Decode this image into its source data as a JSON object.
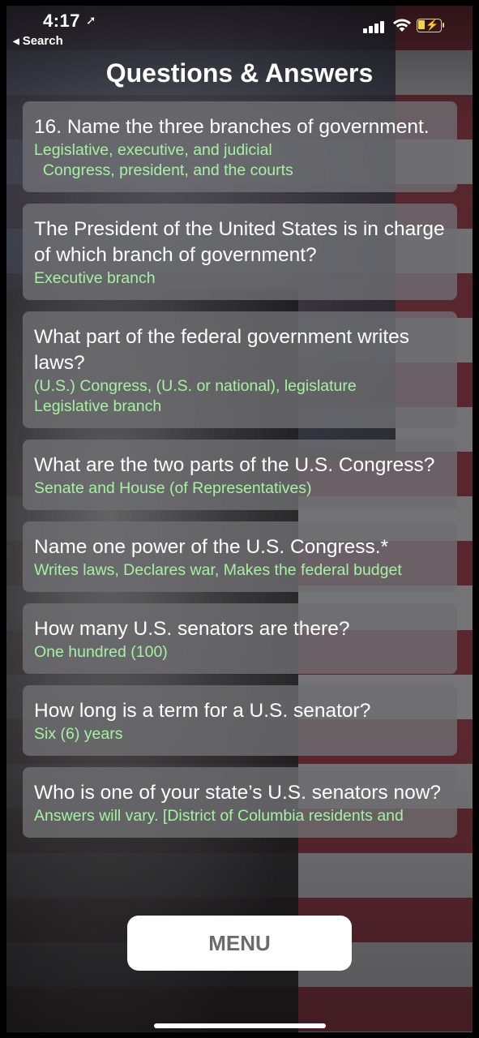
{
  "status_bar": {
    "time": "4:17",
    "back_label": "Search"
  },
  "header": {
    "title": "Questions & Answers"
  },
  "qa_items": [
    {
      "question": "16. Name the three branches of government.",
      "answer": "Legislative, executive, and judicial\n  Congress, president, and the courts"
    },
    {
      "question": "The President of the United States is in charge of which branch of government?",
      "answer": "Executive branch"
    },
    {
      "question": "What part of the federal government writes laws?",
      "answer": "(U.S.) Congress, (U.S. or national), legislature\nLegislative branch"
    },
    {
      "question": "What are the two parts of the U.S. Congress?",
      "answer": "Senate and House (of Representatives)"
    },
    {
      "question": "Name one power of the U.S. Congress.*",
      "answer": "Writes laws, Declares war, Makes the federal budget"
    },
    {
      "question": "How many U.S. senators are there?",
      "answer": "One hundred (100)"
    },
    {
      "question": "How long is a term for a U.S. senator?",
      "answer": "Six (6) years"
    },
    {
      "question": "Who is one of your state’s U.S. senators now?",
      "answer": "Answers will vary. [District of Columbia residents and"
    }
  ],
  "footer": {
    "menu_label": "MENU"
  },
  "colors": {
    "answer_green": "#a5f2a0",
    "card_background": "#6e6e72",
    "menu_text": "#6b6b6b"
  }
}
